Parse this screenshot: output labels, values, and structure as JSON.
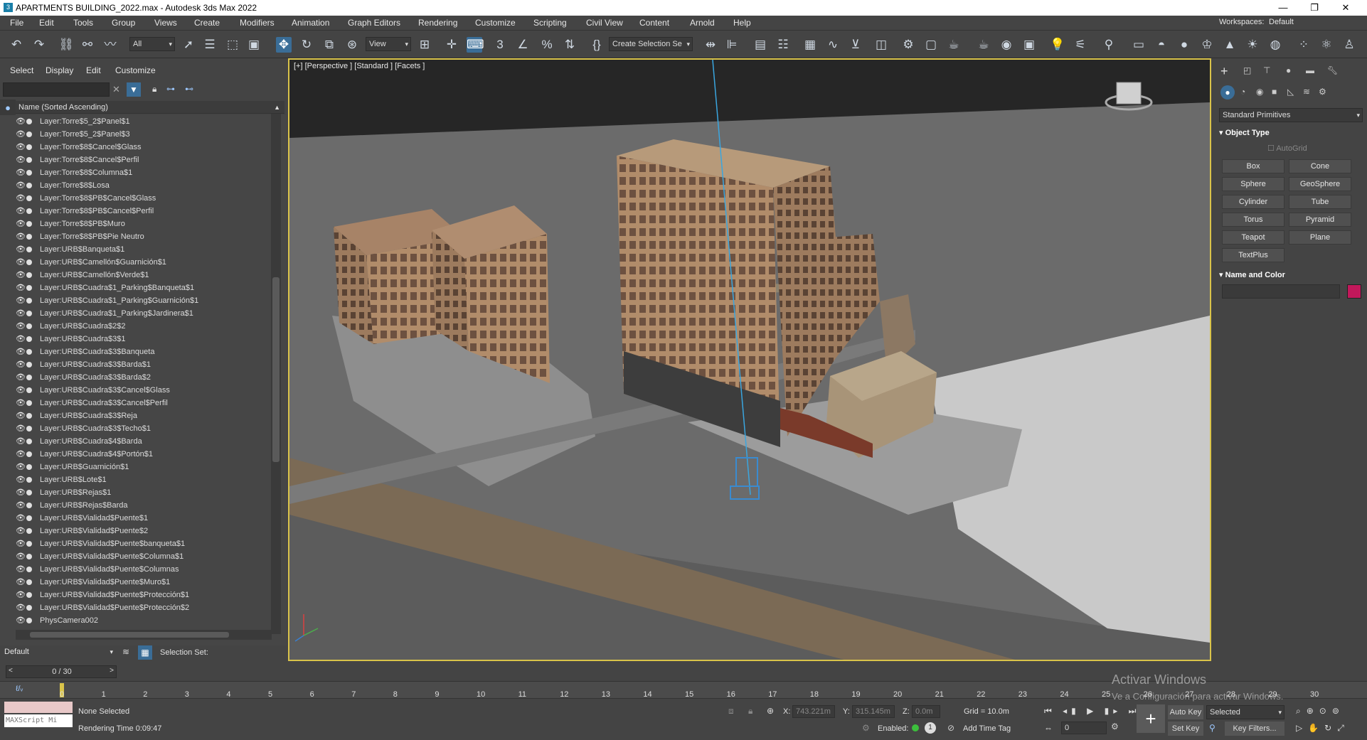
{
  "window": {
    "title": "APARTMENTS BUILDING_2022.max - Autodesk 3ds Max 2022",
    "minimize": "—",
    "restore": "❐",
    "close": "✕"
  },
  "menu": [
    "File",
    "Edit",
    "Tools",
    "Group",
    "Views",
    "Create",
    "Modifiers",
    "Animation",
    "Graph Editors",
    "Rendering",
    "Customize",
    "Scripting",
    "Civil View",
    "Content",
    "Arnold",
    "Help"
  ],
  "workspaces": {
    "label": "Workspaces:",
    "value": "Default"
  },
  "toolbar": {
    "filter_dropdown": "All",
    "view_dropdown": "View",
    "selection_set_dropdown": "Create Selection Se"
  },
  "explorer": {
    "tabs": [
      "Select",
      "Display",
      "Edit",
      "Customize"
    ],
    "header": "Name (Sorted Ascending)",
    "items": [
      "Layer:Torre$5_2$Panel$1",
      "Layer:Torre$5_2$Panel$3",
      "Layer:Torre$8$Cancel$Glass",
      "Layer:Torre$8$Cancel$Perfil",
      "Layer:Torre$8$Columna$1",
      "Layer:Torre$8$Losa",
      "Layer:Torre$8$PB$Cancel$Glass",
      "Layer:Torre$8$PB$Cancel$Perfil",
      "Layer:Torre$8$PB$Muro",
      "Layer:Torre$8$PB$Pie Neutro",
      "Layer:URB$Banqueta$1",
      "Layer:URB$Camellón$Guarnición$1",
      "Layer:URB$Camellón$Verde$1",
      "Layer:URB$Cuadra$1_Parking$Banqueta$1",
      "Layer:URB$Cuadra$1_Parking$Guarnición$1",
      "Layer:URB$Cuadra$1_Parking$Jardinera$1",
      "Layer:URB$Cuadra$2$2",
      "Layer:URB$Cuadra$3$1",
      "Layer:URB$Cuadra$3$Banqueta",
      "Layer:URB$Cuadra$3$Barda$1",
      "Layer:URB$Cuadra$3$Barda$2",
      "Layer:URB$Cuadra$3$Cancel$Glass",
      "Layer:URB$Cuadra$3$Cancel$Perfil",
      "Layer:URB$Cuadra$3$Reja",
      "Layer:URB$Cuadra$3$Techo$1",
      "Layer:URB$Cuadra$4$Barda",
      "Layer:URB$Cuadra$4$Portón$1",
      "Layer:URB$Guarnición$1",
      "Layer:URB$Lote$1",
      "Layer:URB$Rejas$1",
      "Layer:URB$Rejas$Barda",
      "Layer:URB$Vialidad$Puente$1",
      "Layer:URB$Vialidad$Puente$2",
      "Layer:URB$Vialidad$Puente$banqueta$1",
      "Layer:URB$Vialidad$Puente$Columna$1",
      "Layer:URB$Vialidad$Puente$Columnas",
      "Layer:URB$Vialidad$Puente$Muro$1",
      "Layer:URB$Vialidad$Puente$Protección$1",
      "Layer:URB$Vialidad$Puente$Protección$2",
      "PhysCamera002"
    ],
    "layer_dropdown": "Default",
    "selection_set_label": "Selection Set:"
  },
  "viewport": {
    "label": "[+] [Perspective ] [Standard ] [Facets ]"
  },
  "command_panel": {
    "dropdown": "Standard Primitives",
    "object_type_title": "Object Type",
    "autogrid": "AutoGrid",
    "buttons": [
      "Box",
      "Cone",
      "Sphere",
      "GeoSphere",
      "Cylinder",
      "Tube",
      "Torus",
      "Pyramid",
      "Teapot",
      "Plane",
      "TextPlus"
    ],
    "name_color_title": "Name and Color",
    "swatch_color": "#c2185b"
  },
  "timeline": {
    "frame_counter": "0 / 30",
    "ticks": [
      "0",
      "1",
      "2",
      "3",
      "4",
      "5",
      "6",
      "7",
      "8",
      "9",
      "10",
      "11",
      "12",
      "13",
      "14",
      "15",
      "16",
      "17",
      "18",
      "19",
      "20",
      "21",
      "22",
      "23",
      "24",
      "25",
      "26",
      "27",
      "28",
      "29",
      "30"
    ]
  },
  "status": {
    "maxscript": "MAXScript Mi",
    "selection": "None Selected",
    "rendering_time": "Rendering Time  0:09:47",
    "x_label": "X:",
    "x_value": "743.221m",
    "y_label": "Y:",
    "y_value": "315.145m",
    "z_label": "Z:",
    "z_value": "0.0m",
    "grid": "Grid = 10.0m",
    "enabled": "Enabled:",
    "add_time_tag": "Add Time Tag",
    "auto_key": "Auto Key",
    "set_key": "Set Key",
    "key_mode": "Selected",
    "key_filters": "Key Filters...",
    "frame_field": "0",
    "activate_line1": "Activar Windows",
    "activate_line2": "Ve a Configuración para activar Windows."
  }
}
